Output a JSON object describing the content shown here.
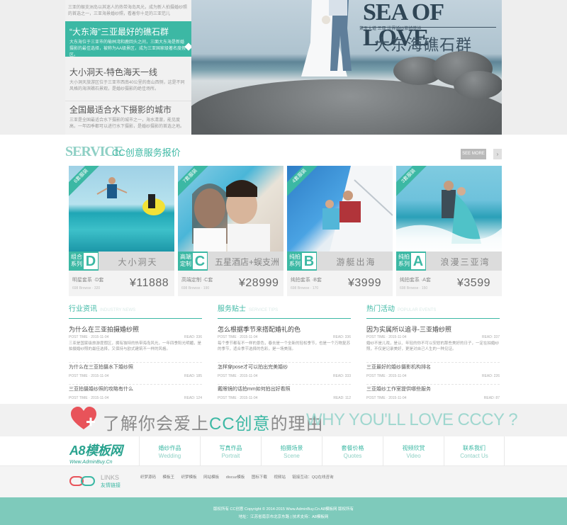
{
  "news": {
    "items": [
      {
        "title": "",
        "desc": "三亚的蜈支洲岛以其迷人的热带海岛风光，成为新人拍摄婚纱照的首选之一，三亚海景婚纱照，看着你十足的三亚范儿"
      },
      {
        "title": "“大东海”三亚最好的礁石群",
        "desc": "大东海位于三亚市的榆林湾和鹿回头之间，三面大东海是新婚摄影的最佳选择，被称为AA级景区，成为三亚国家级著名度假区。"
      },
      {
        "title": "大小洞天-特色海天一线",
        "desc": "大小洞天旅游区位于三亚市西南40公里的南山西侧，这是不同风格的海滨礁石景观，是婚纱摄影的绝佳场所。"
      },
      {
        "title": "全国最适合水下摄影的城市",
        "desc": "三亚是全国最适合水下摄影的城市之一，海水清澈，能见度高，一年四季都可以进行水下摄影，是婚纱摄影的首选之地。"
      }
    ]
  },
  "hero": {
    "title_en": "SEA OF LOVE",
    "subtitle": "第五大道 三亚 世界婚纱旅拍基地",
    "title_cn": "大东海礁石群"
  },
  "service": {
    "title_en": "SERVICE",
    "title_cn": "CC创意服务报价",
    "see_more": "SEE MORE",
    "arrow": "›",
    "cards": [
      {
        "corner": "6套服装",
        "series_small": "组合系列",
        "series_letter": "D",
        "name": "大小洞天",
        "sub": "明星套系 ·D套",
        "sub2": "698 Browse · 320",
        "price": "¥11888"
      },
      {
        "corner": "7套服装",
        "series_small": "高端定制",
        "series_letter": "C",
        "name": "五星酒店+蜈支洲",
        "sub": "高端定制 ·C套",
        "sub2": "698 Browse · 190",
        "price": "¥28999"
      },
      {
        "corner": "4套服装",
        "series_small": "纯拍系列",
        "series_letter": "B",
        "name": "游艇出海",
        "sub": "纯拍套系 ·B套",
        "sub2": "698 Browse · 170",
        "price": "¥3999"
      },
      {
        "corner": "3套服装",
        "series_small": "纯拍系列",
        "series_letter": "A",
        "name": "浪漫三亚湾",
        "sub": "纯拍套系 ·A套",
        "sub2": "698 Browse · 150",
        "price": "¥3599"
      }
    ]
  },
  "columns": [
    {
      "head": "行业资讯",
      "head_en": "INDUSTRY NEWS",
      "big_title": "为什么在三亚拍摄婚纱照",
      "big_time": "POST TIME · 2015-11-04",
      "big_read": "READ: 336",
      "excerpt": "三亚是国家级旅游度假区，拥有独特的热带海岛风光，一年四季阳光明媚，是拍摄婚纱照的最佳选择，又保持与欧式建筑不一样的风格。",
      "small": [
        {
          "title": "为什么在三亚拍摄水下婚纱照",
          "time": "POST TIME · 2015-11-04",
          "read": "READ: 185"
        },
        {
          "title": "三亚拍摄婚纱照的攻略有什么",
          "time": "POST TIME · 2015-11-04",
          "read": "READ: 124"
        }
      ]
    },
    {
      "head": "服务贴士",
      "head_en": "SERVICE TIPS",
      "big_title": "怎么根据季节来搭配婚礼的色",
      "big_time": "POST TIME · 2015-11-04",
      "big_read": "READ: 336",
      "excerpt": "每个季节都有不一样的景色，春去是一个全新的轻松季节，也是一个万物复苏的季节，适合季节选择的色彩，是一场美丽。",
      "small": [
        {
          "title": "怎样穿pose才可以拍出完美婚纱",
          "time": "POST TIME · 2015-11-04",
          "read": "READ: 333"
        },
        {
          "title": "戴眼镜的话拍mm如何拍出好看照",
          "time": "POST TIME · 2015-11-04",
          "read": "READ: 112"
        }
      ]
    },
    {
      "head": "热门活动",
      "head_en": "POPULAR EVENTS",
      "big_title": "因为实属所以追寻-三亚婚纱照",
      "big_time": "POST TIME · 2015-11-04",
      "big_read": "READ: 337",
      "excerpt": "婚纱不是儿戏，是认、年轻的你不可以安慰的那些美好的日子，一定在拍婚纱照，不仅是记录美好，更是对自己人生的一种见证。",
      "small": [
        {
          "title": "三亚最好的婚纱摄影机构排名",
          "time": "POST TIME · 2015-11-04",
          "read": "READ: 226"
        },
        {
          "title": "三亚婚纱工作室提供哪些服务",
          "time": "POST TIME · 2015-11-04",
          "read": "READ: 87"
        }
      ]
    }
  ],
  "slogan": {
    "part1": "了解你会爱上",
    "brand": "CC创意",
    "part2": "的理由",
    "en": "WHY YOU'LL LOVE CCCY ?"
  },
  "logo": {
    "main": "A8模板网",
    "url": "Www.AdminBuy.Cn"
  },
  "nav": [
    {
      "cn": "婚纱作品",
      "en": "Wedding"
    },
    {
      "cn": "写真作品",
      "en": "Portrait"
    },
    {
      "cn": "拍摄场景",
      "en": "Scene"
    },
    {
      "cn": "套餐价格",
      "en": "Quotes"
    },
    {
      "cn": "视频欣赏",
      "en": "Video"
    },
    {
      "cn": "联系我们",
      "en": "Contact Us"
    }
  ],
  "links": {
    "label_en": "LINKS",
    "label_cn": "友情链接",
    "items": [
      "织梦源码",
      "模板王",
      "织梦模板",
      "网站模板",
      "discuz模板",
      "图标下载",
      "视频站",
      "链接互动：QQ在线咨询"
    ]
  },
  "footer": {
    "line1": "版权所有 CC创意 Copyright © 2014-2015 Www.AdminBuy.Cn A8模板网 版权所有",
    "line2": "地址：江苏省南京市北京东路 | 技术支持：A8模板网"
  },
  "colors": {
    "accent": "#3cb8a4",
    "accent_light": "#8fd0c5",
    "footer_bg": "#7ecabb"
  }
}
